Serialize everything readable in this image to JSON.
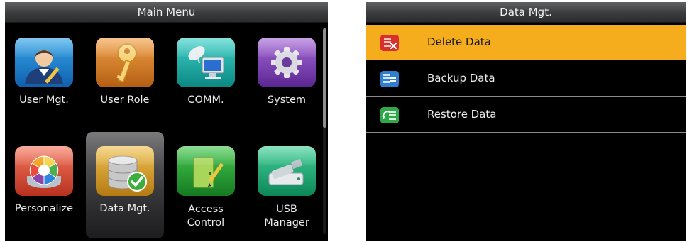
{
  "main_menu": {
    "title": "Main Menu",
    "items": [
      {
        "label": "User Mgt.",
        "icon": "user-icon"
      },
      {
        "label": "User Role",
        "icon": "key-icon"
      },
      {
        "label": "COMM.",
        "icon": "satellite-computer-icon"
      },
      {
        "label": "System",
        "icon": "gear-icon"
      },
      {
        "label": "Personalize",
        "icon": "color-wheel-icon"
      },
      {
        "label": "Data Mgt.",
        "icon": "database-check-icon",
        "selected": true
      },
      {
        "label_line1": "Access",
        "label_line2": "Control",
        "icon": "door-pencil-icon"
      },
      {
        "label_line1": "USB",
        "label_line2": "Manager",
        "icon": "usb-drive-icon"
      }
    ]
  },
  "data_mgt": {
    "title": "Data Mgt.",
    "items": [
      {
        "label": "Delete Data",
        "icon": "delete-data-icon",
        "selected": true
      },
      {
        "label": "Backup Data",
        "icon": "backup-data-icon"
      },
      {
        "label": "Restore Data",
        "icon": "restore-data-icon"
      }
    ]
  },
  "colors": {
    "highlight": "#f6ad1d",
    "screen_background": "#000000",
    "title_bar": "#4a4b4d"
  }
}
